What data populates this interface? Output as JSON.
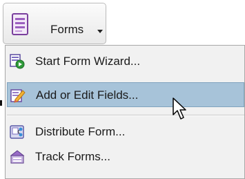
{
  "toolbar": {
    "forms_button": {
      "label": "Forms",
      "icon": "forms-document-icon",
      "arrow_icon": "chevron-down-icon"
    }
  },
  "menu": {
    "items": [
      {
        "label": "Start Form Wizard...",
        "icon": "form-wizard-icon",
        "highlighted": false
      },
      {
        "label": "Add or Edit Fields...",
        "icon": "edit-fields-icon",
        "highlighted": true
      },
      {
        "label": "Distribute Form...",
        "icon": "distribute-form-icon",
        "highlighted": false
      },
      {
        "label": "Track Forms...",
        "icon": "track-forms-icon",
        "highlighted": false
      }
    ]
  },
  "colors": {
    "highlight": "#a7c3d9",
    "menu_background": "#f1f1f1",
    "forms_icon_purple": "#7a3f9d"
  }
}
